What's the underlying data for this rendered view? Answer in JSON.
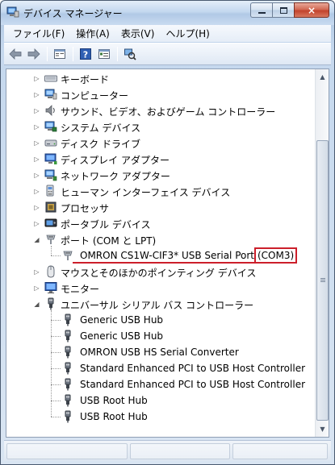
{
  "window": {
    "title": "デバイス マネージャー",
    "controls": {
      "minimize": "minimize",
      "maximize": "maximize",
      "close": "×"
    }
  },
  "menubar": {
    "items": [
      {
        "label": "ファイル(F)"
      },
      {
        "label": "操作(A)"
      },
      {
        "label": "表示(V)"
      },
      {
        "label": "ヘルプ(H)"
      }
    ]
  },
  "toolbar": {
    "buttons": [
      "back-arrow-icon",
      "forward-arrow-icon",
      "properties-icon",
      "help-icon",
      "view-icon",
      "scan-hardware-icon"
    ]
  },
  "tree": {
    "nodes": [
      {
        "label": "キーボード",
        "icon": "keyboard-icon",
        "expanded": false
      },
      {
        "label": "コンピューター",
        "icon": "computer-icon",
        "expanded": false
      },
      {
        "label": "サウンド、ビデオ、およびゲーム コントローラー",
        "icon": "speaker-icon",
        "expanded": false
      },
      {
        "label": "システム デバイス",
        "icon": "system-device-icon",
        "expanded": false
      },
      {
        "label": "ディスク ドライブ",
        "icon": "disk-drive-icon",
        "expanded": false
      },
      {
        "label": "ディスプレイ アダプター",
        "icon": "display-adapter-icon",
        "expanded": false
      },
      {
        "label": "ネットワーク アダプター",
        "icon": "network-adapter-icon",
        "expanded": false
      },
      {
        "label": "ヒューマン インターフェイス デバイス",
        "icon": "hid-icon",
        "expanded": false
      },
      {
        "label": "プロセッサ",
        "icon": "processor-icon",
        "expanded": false
      },
      {
        "label": "ポータブル デバイス",
        "icon": "portable-device-icon",
        "expanded": false
      },
      {
        "label": "ポート (COM と LPT)",
        "icon": "port-icon",
        "expanded": true,
        "children": [
          {
            "label_main": "OMRON CS1W-CIF3* USB Serial Port",
            "label_port": "(COM3)",
            "icon": "port-icon"
          }
        ]
      },
      {
        "label": "マウスとそのほかのポインティング デバイス",
        "icon": "mouse-icon",
        "expanded": false
      },
      {
        "label": "モニター",
        "icon": "monitor-icon",
        "expanded": false
      },
      {
        "label": "ユニバーサル シリアル バス コントローラー",
        "icon": "usb-icon",
        "expanded": true,
        "children": [
          {
            "label": "Generic USB Hub",
            "icon": "usb-device-icon"
          },
          {
            "label": "Generic USB Hub",
            "icon": "usb-device-icon"
          },
          {
            "label": "OMRON USB HS Serial Converter",
            "icon": "usb-device-icon"
          },
          {
            "label": "Standard Enhanced PCI to USB Host Controller",
            "icon": "usb-device-icon"
          },
          {
            "label": "Standard Enhanced PCI to USB Host Controller",
            "icon": "usb-device-icon"
          },
          {
            "label": "USB Root Hub",
            "icon": "usb-device-icon"
          },
          {
            "label": "USB Root Hub",
            "icon": "usb-device-icon"
          }
        ]
      }
    ]
  },
  "highlight_color": "#cc1f2b"
}
